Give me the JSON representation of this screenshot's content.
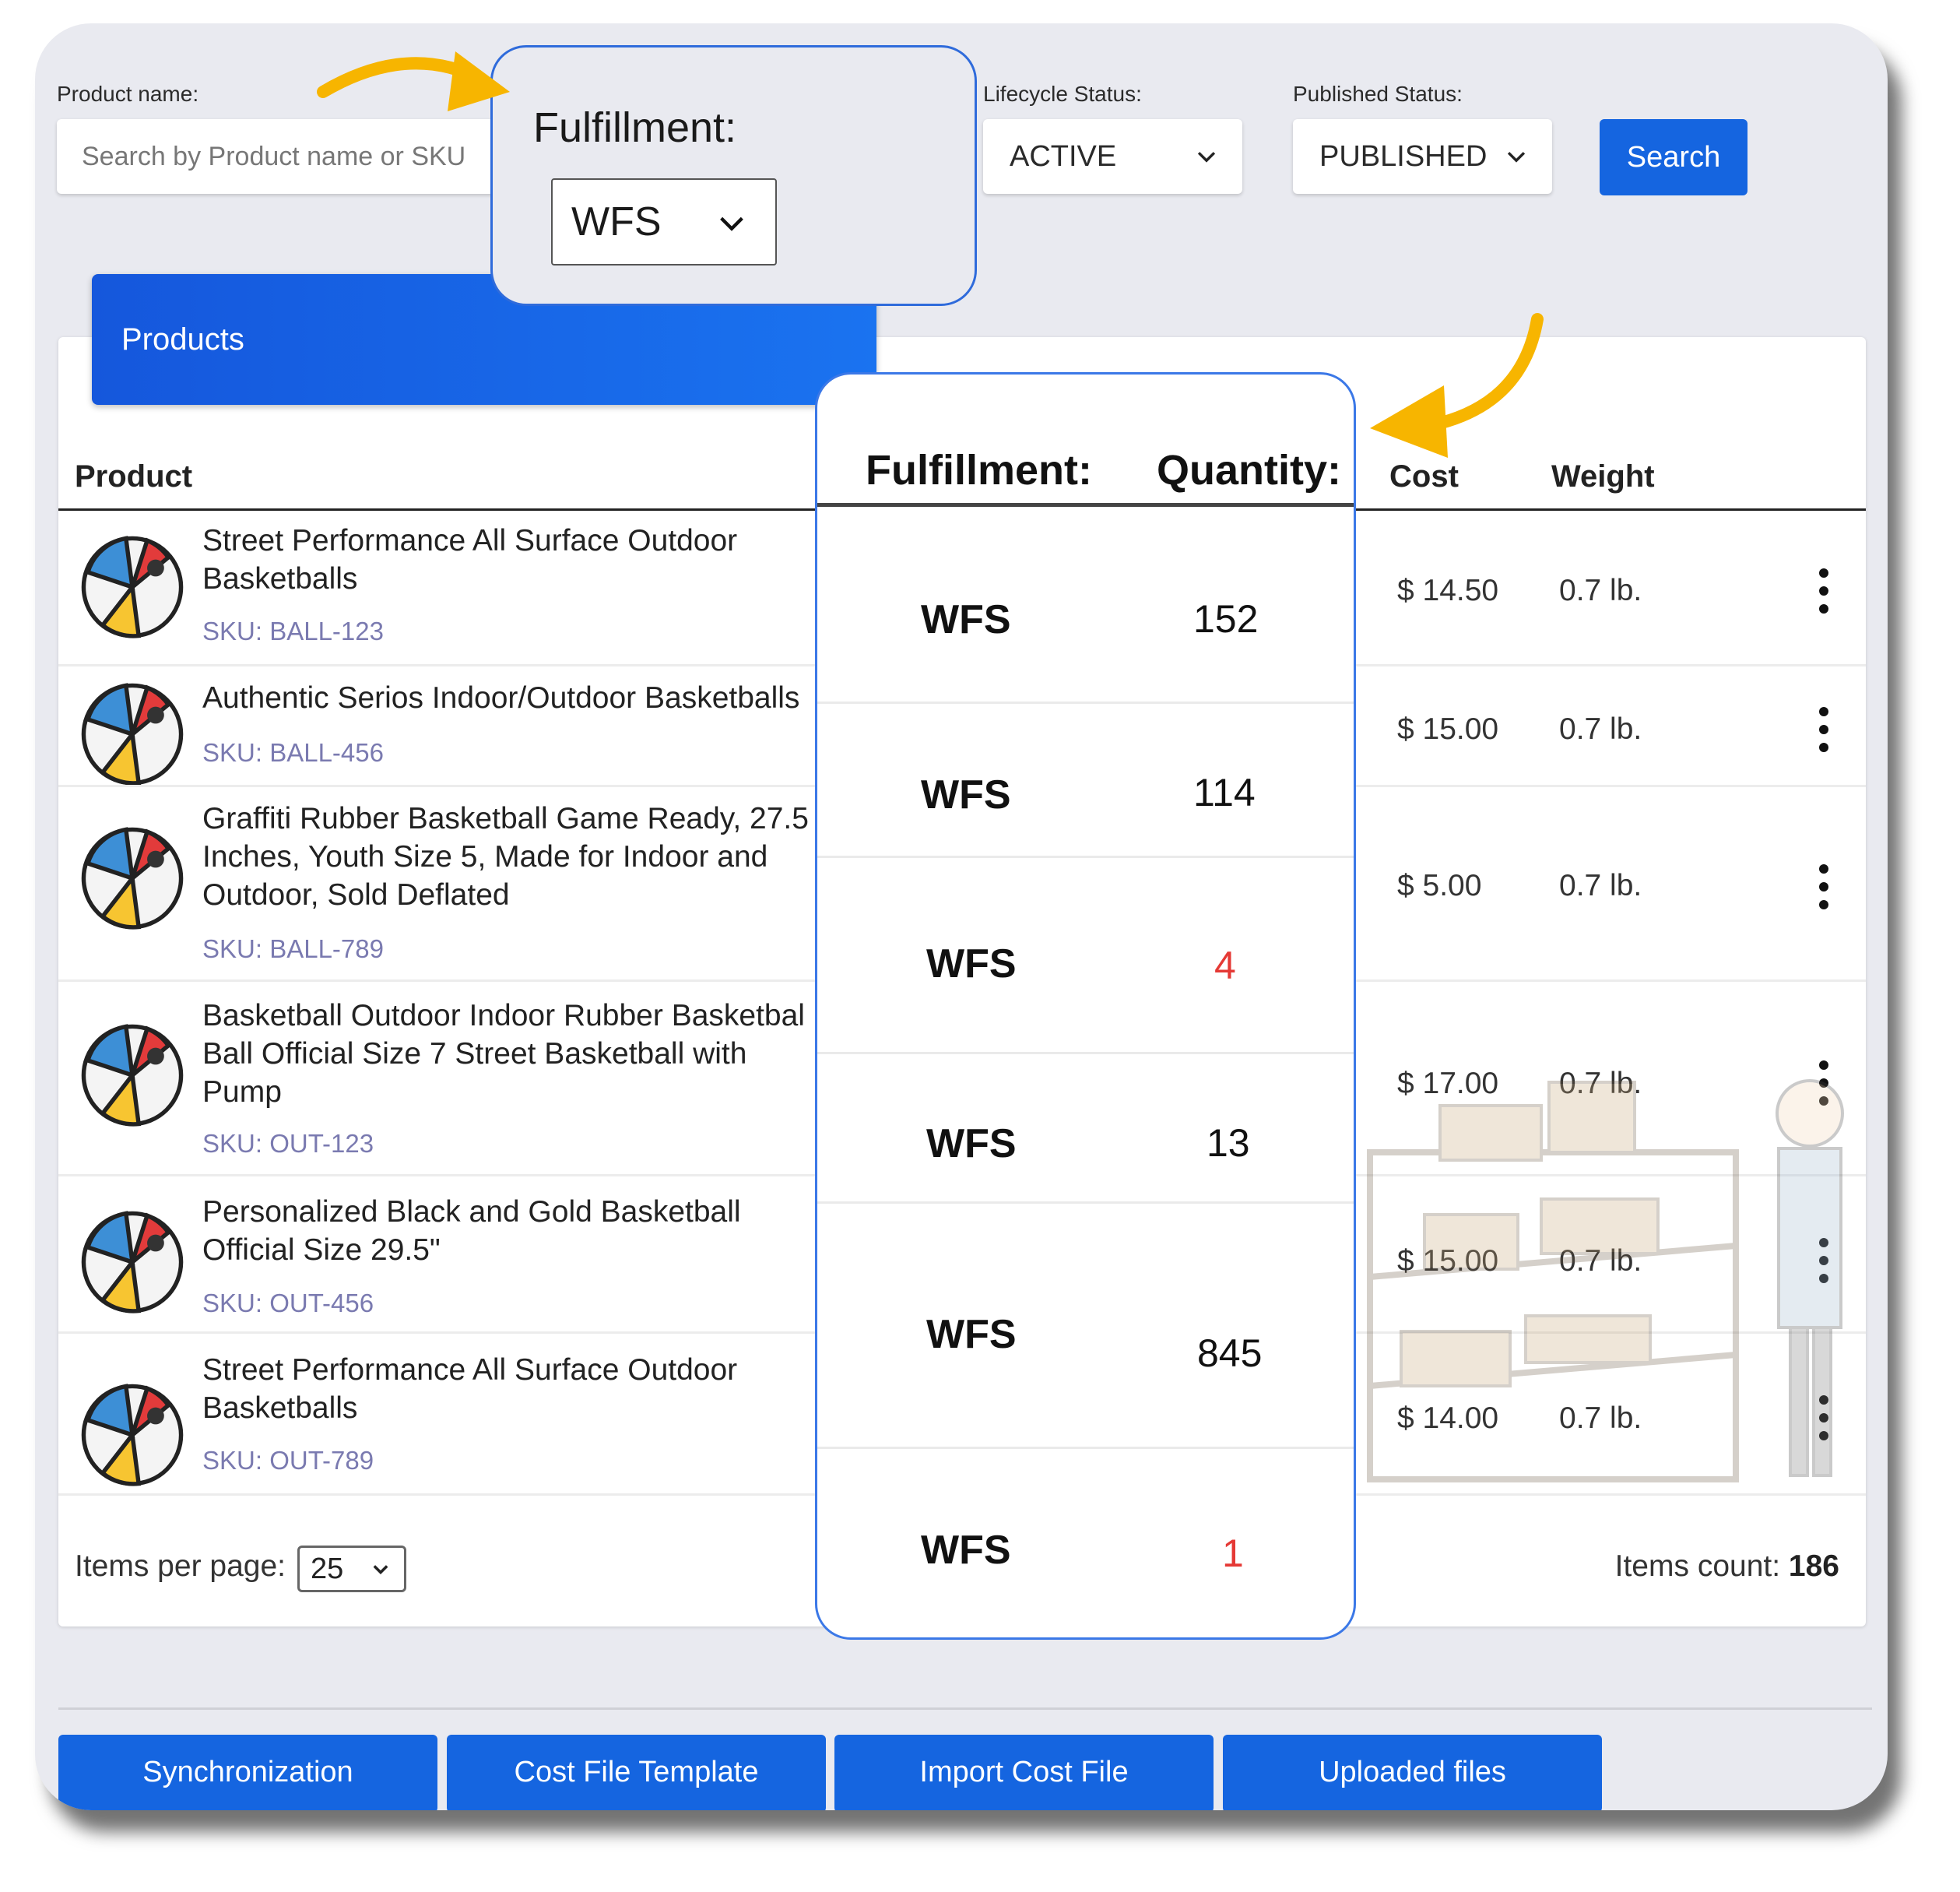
{
  "filters": {
    "product_name_label": "Product name:",
    "search_placeholder": "Search by Product name or SKU",
    "lifecycle_label": "Lifecycle Status:",
    "lifecycle_value": "ACTIVE",
    "published_label": "Published Status:",
    "published_value": "PUBLISHED",
    "search_button": "Search"
  },
  "fulfillment_callout": {
    "label": "Fulfillment:",
    "value": "WFS"
  },
  "products_tab": "Products",
  "table": {
    "headers": {
      "product": "Product",
      "cost": "Cost",
      "weight": "Weight"
    },
    "rows": [
      {
        "name": "Street Performance All Surface Outdoor\nBasketballs",
        "sku": "SKU: BALL-123",
        "cost": "$ 14.50",
        "weight": "0.7 lb."
      },
      {
        "name": "Authentic Serios Indoor/Outdoor Basketballs",
        "sku": "SKU: BALL-456",
        "cost": "$ 15.00",
        "weight": "0.7 lb."
      },
      {
        "name": "Graffiti Rubber Basketball Game Ready, 27.5\nInches, Youth Size 5, Made for Indoor and\nOutdoor, Sold Deflated",
        "sku": "SKU: BALL-789",
        "cost": "$ 5.00",
        "weight": "0.7 lb."
      },
      {
        "name": "Basketball Outdoor Indoor Rubber Basketbal\nBall Official Size 7 Street Basketball with\nPump",
        "sku": "SKU: OUT-123",
        "cost": "$ 17.00",
        "weight": "0.7 lb."
      },
      {
        "name": "Personalized Black and Gold Basketball\nOfficial Size 29.5\"",
        "sku": "SKU: OUT-456",
        "cost": "$ 15.00",
        "weight": "0.7 lb."
      },
      {
        "name": "Street Performance All Surface Outdoor\nBasketballs",
        "sku": "SKU: OUT-789",
        "cost": "$ 14.00",
        "weight": "0.7 lb."
      }
    ]
  },
  "pagination": {
    "items_per_page_label": "Items per page:",
    "items_per_page_value": "25",
    "items_count_label": "Items count:",
    "items_count_value": "186"
  },
  "quantity_callout": {
    "fulfillment_header": "Fulfillment:",
    "quantity_header": "Quantity:",
    "rows": [
      {
        "fulfillment": "WFS",
        "quantity": "152"
      },
      {
        "fulfillment": "WFS",
        "quantity": "114"
      },
      {
        "fulfillment": "WFS",
        "quantity": "4"
      },
      {
        "fulfillment": "WFS",
        "quantity": "13"
      },
      {
        "fulfillment": "WFS",
        "quantity": "845"
      },
      {
        "fulfillment": "WFS",
        "quantity": "1"
      }
    ]
  },
  "bottom_buttons": [
    "Synchronization",
    "Cost File Template",
    "Import Cost File",
    "Uploaded files"
  ],
  "colors": {
    "primary_blue": "#1565e0",
    "low_stock_red": "#e53935",
    "arrow_yellow": "#f7b500",
    "callout_border": "#2f6bdb"
  },
  "icons": [
    "beach-ball-icon",
    "chevron-down-icon",
    "more-vertical-icon",
    "curved-arrow-icon"
  ]
}
